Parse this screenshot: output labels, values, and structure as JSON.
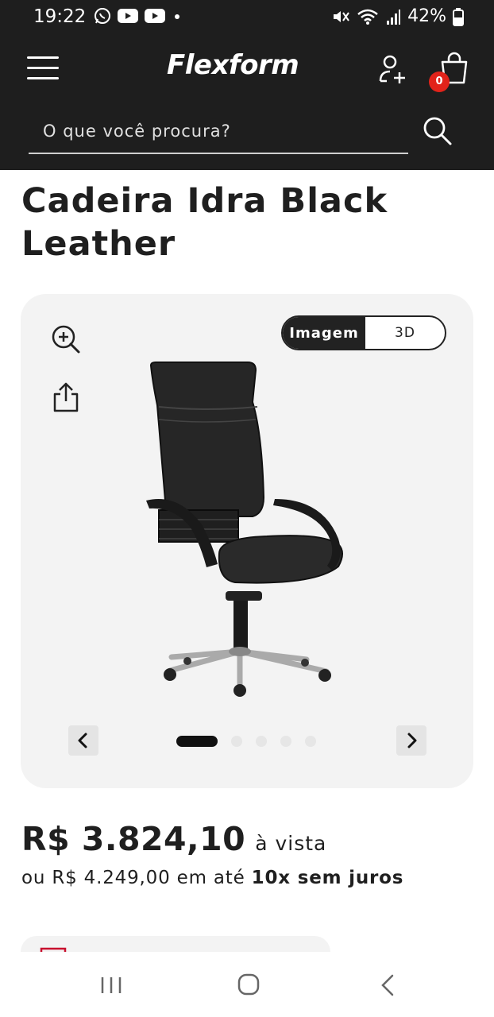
{
  "status_bar": {
    "time": "19:22",
    "battery": "42%",
    "icons": [
      "whatsapp-icon",
      "youtube-icon",
      "youtube-icon",
      "dot-icon",
      "mute-icon",
      "wifi-icon",
      "signal-icon",
      "battery-icon"
    ]
  },
  "header": {
    "logo": "Flexform",
    "cart_count": "0",
    "search_placeholder": "O que você procura?"
  },
  "product": {
    "title": "Cadeira Idra Black Leather",
    "gallery": {
      "toggle_image": "Imagem",
      "toggle_3d": "3D",
      "slide_count": 5,
      "active_slide": 1
    },
    "price": "R$ 3.824,10",
    "price_condition": "à vista",
    "installment_prefix": "ou R$ 4.249,00 em até",
    "installment_bold": "10x sem juros"
  },
  "colors": {
    "header_bg": "#1e1e1e",
    "badge": "#e2231a",
    "gallery_bg": "#f3f3f3",
    "text": "#1f1f1f"
  }
}
